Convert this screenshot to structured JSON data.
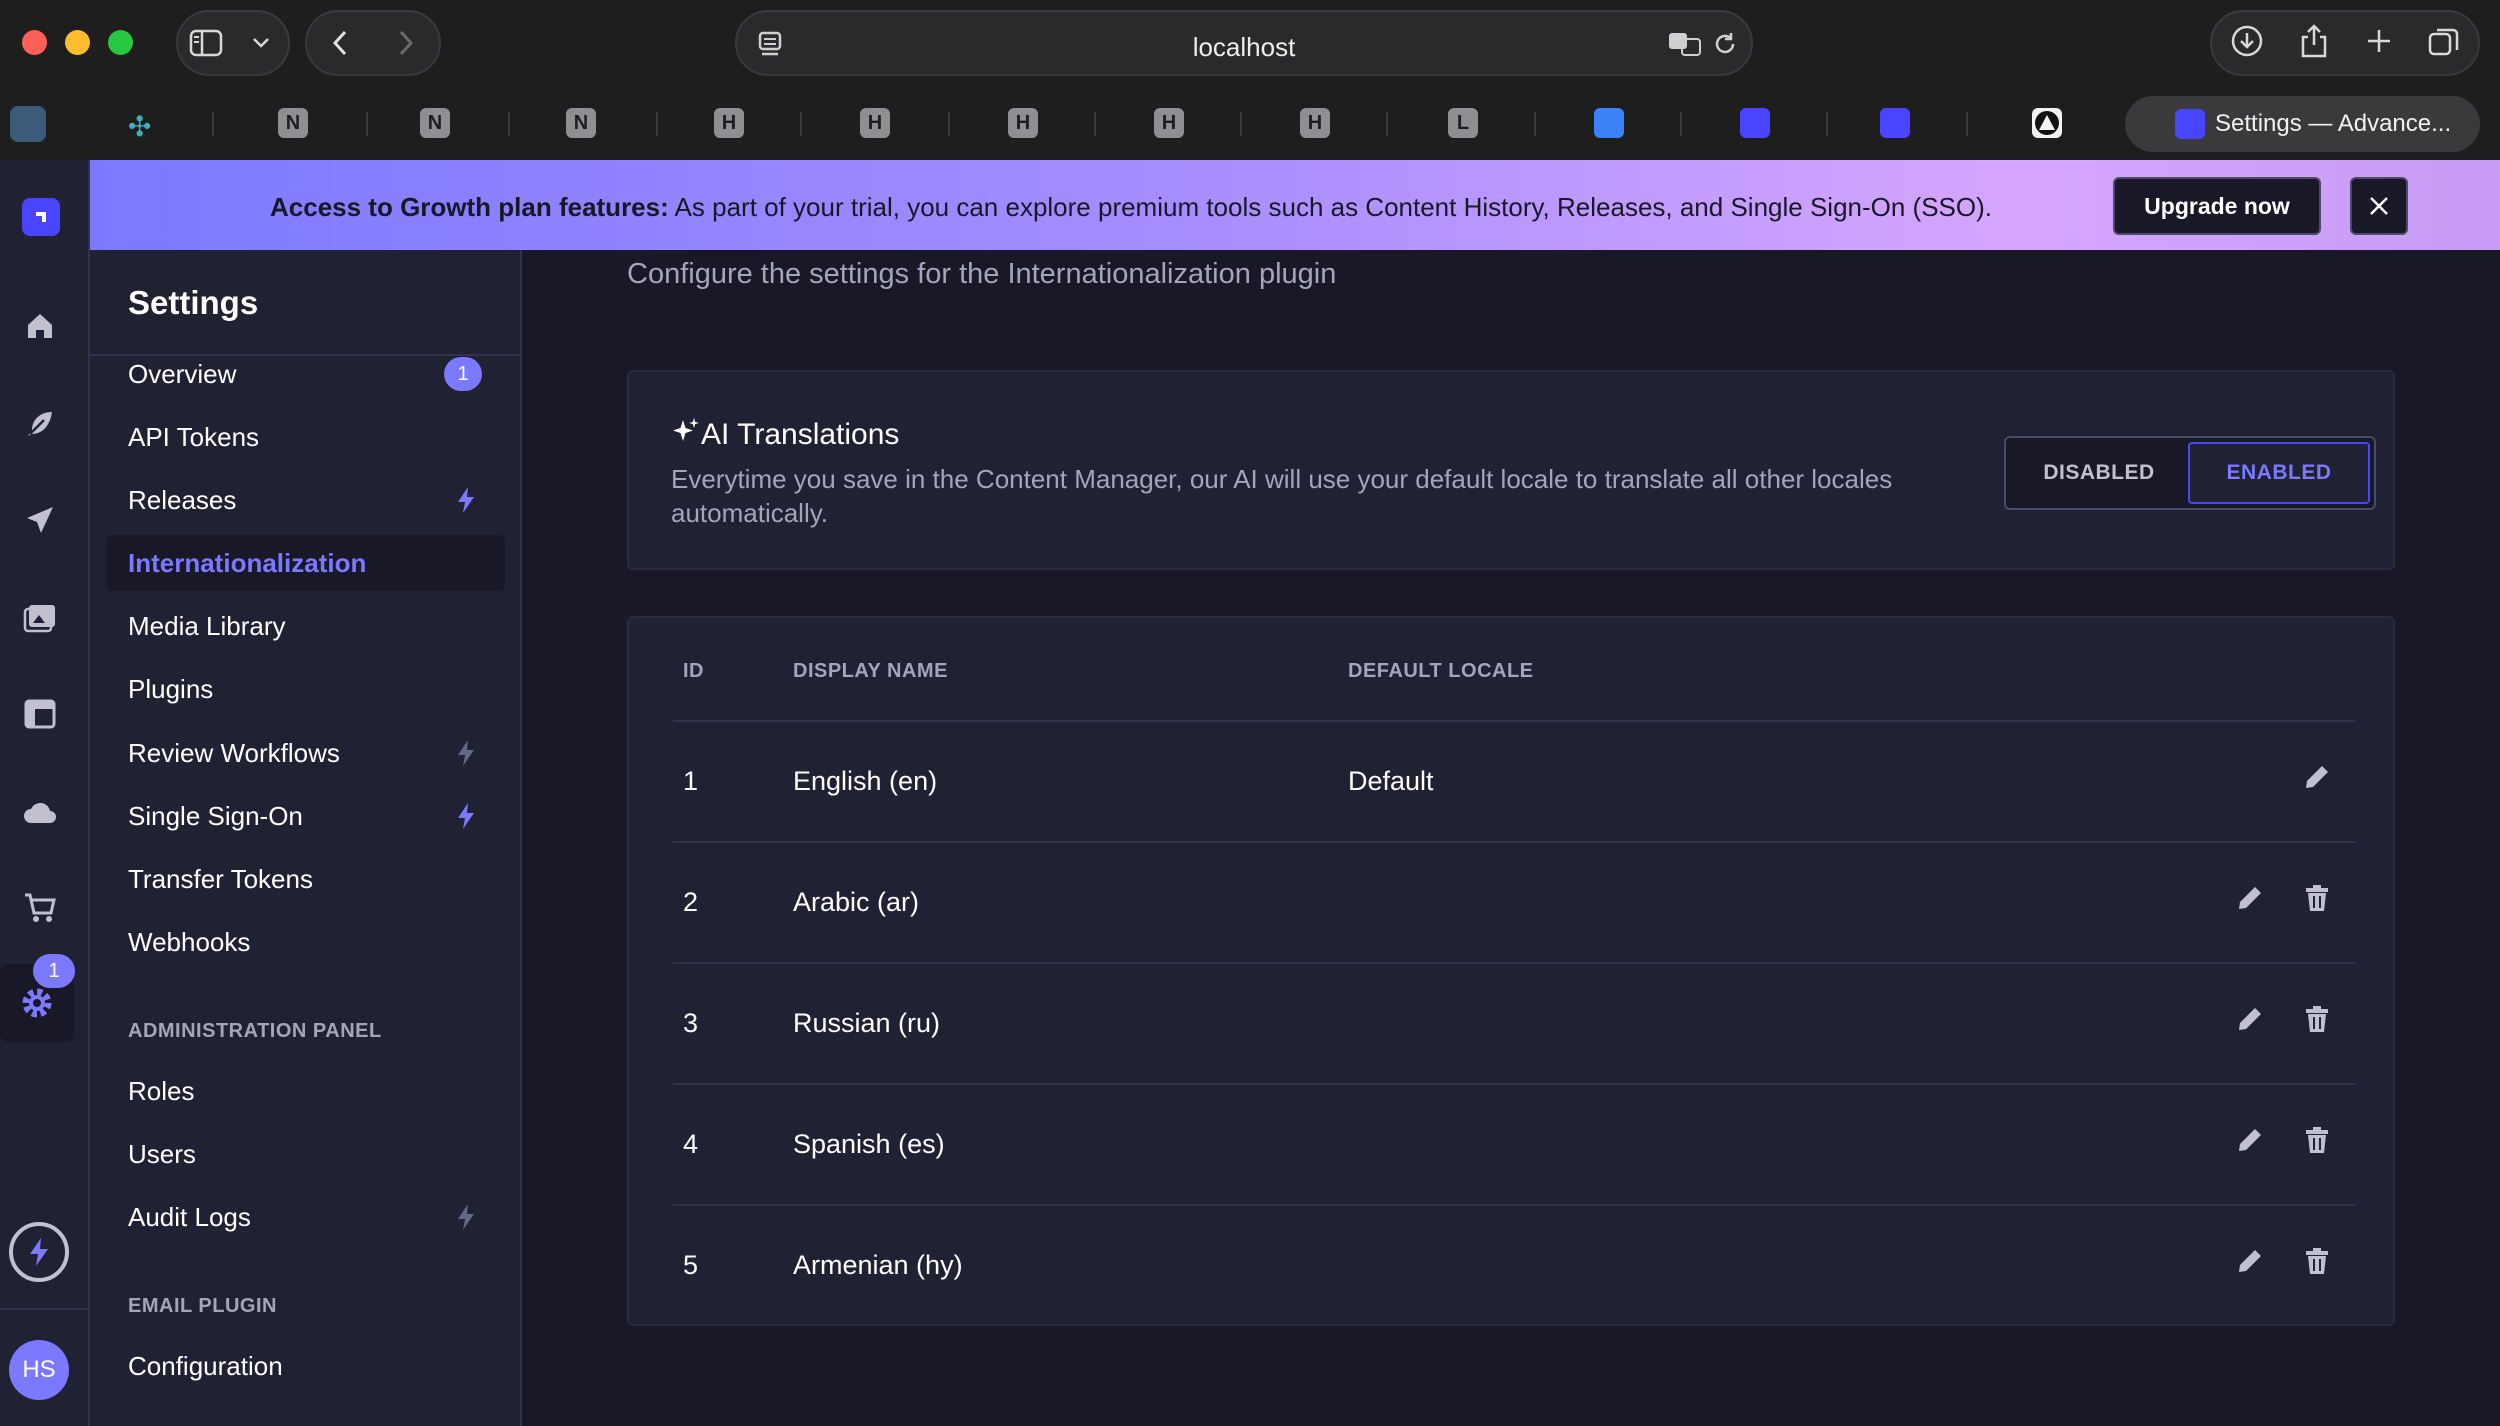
{
  "browser": {
    "url": "localhost",
    "active_tab_title": "Settings — Advance...",
    "tab_letters": [
      "N",
      "N",
      "N",
      "H",
      "H",
      "H",
      "H",
      "H",
      "L"
    ]
  },
  "banner": {
    "bold": "Access to Growth plan features:",
    "text": " As part of your trial, you can explore premium tools such as Content History, Releases, and Single Sign-On (SSO).",
    "upgrade": "Upgrade now"
  },
  "rail": {
    "settings_badge": "1",
    "avatar_initials": "HS"
  },
  "settings_nav": {
    "title": "Settings",
    "items": [
      {
        "label": "Overview",
        "count": "1"
      },
      {
        "label": "API Tokens"
      },
      {
        "label": "Releases"
      },
      {
        "label": "Internationalization"
      },
      {
        "label": "Media Library"
      },
      {
        "label": "Plugins"
      },
      {
        "label": "Review Workflows"
      },
      {
        "label": "Single Sign-On"
      },
      {
        "label": "Transfer Tokens"
      },
      {
        "label": "Webhooks"
      }
    ],
    "admin_section": "ADMINISTRATION PANEL",
    "admin_items": [
      {
        "label": "Roles"
      },
      {
        "label": "Users"
      },
      {
        "label": "Audit Logs"
      }
    ],
    "email_section": "EMAIL PLUGIN",
    "email_items": [
      {
        "label": "Configuration"
      }
    ]
  },
  "main": {
    "description": "Configure the settings for the Internationalization plugin",
    "ai": {
      "title": "AI Translations",
      "text": "Everytime you save in the Content Manager, our AI will use your default locale to translate all other locales automatically.",
      "disabled_label": "DISABLED",
      "enabled_label": "ENABLED",
      "state": "enabled"
    },
    "table": {
      "headers": {
        "id": "ID",
        "name": "DISPLAY NAME",
        "default": "DEFAULT LOCALE"
      },
      "rows": [
        {
          "id": "1",
          "name": "English (en)",
          "default": "Default"
        },
        {
          "id": "2",
          "name": "Arabic (ar)",
          "default": ""
        },
        {
          "id": "3",
          "name": "Russian (ru)",
          "default": ""
        },
        {
          "id": "4",
          "name": "Spanish (es)",
          "default": ""
        },
        {
          "id": "5",
          "name": "Armenian (hy)",
          "default": ""
        }
      ]
    }
  },
  "colors": {
    "accent": "#7b79ff",
    "primary": "#4945ff",
    "background": "#181826",
    "surface": "#212134"
  }
}
